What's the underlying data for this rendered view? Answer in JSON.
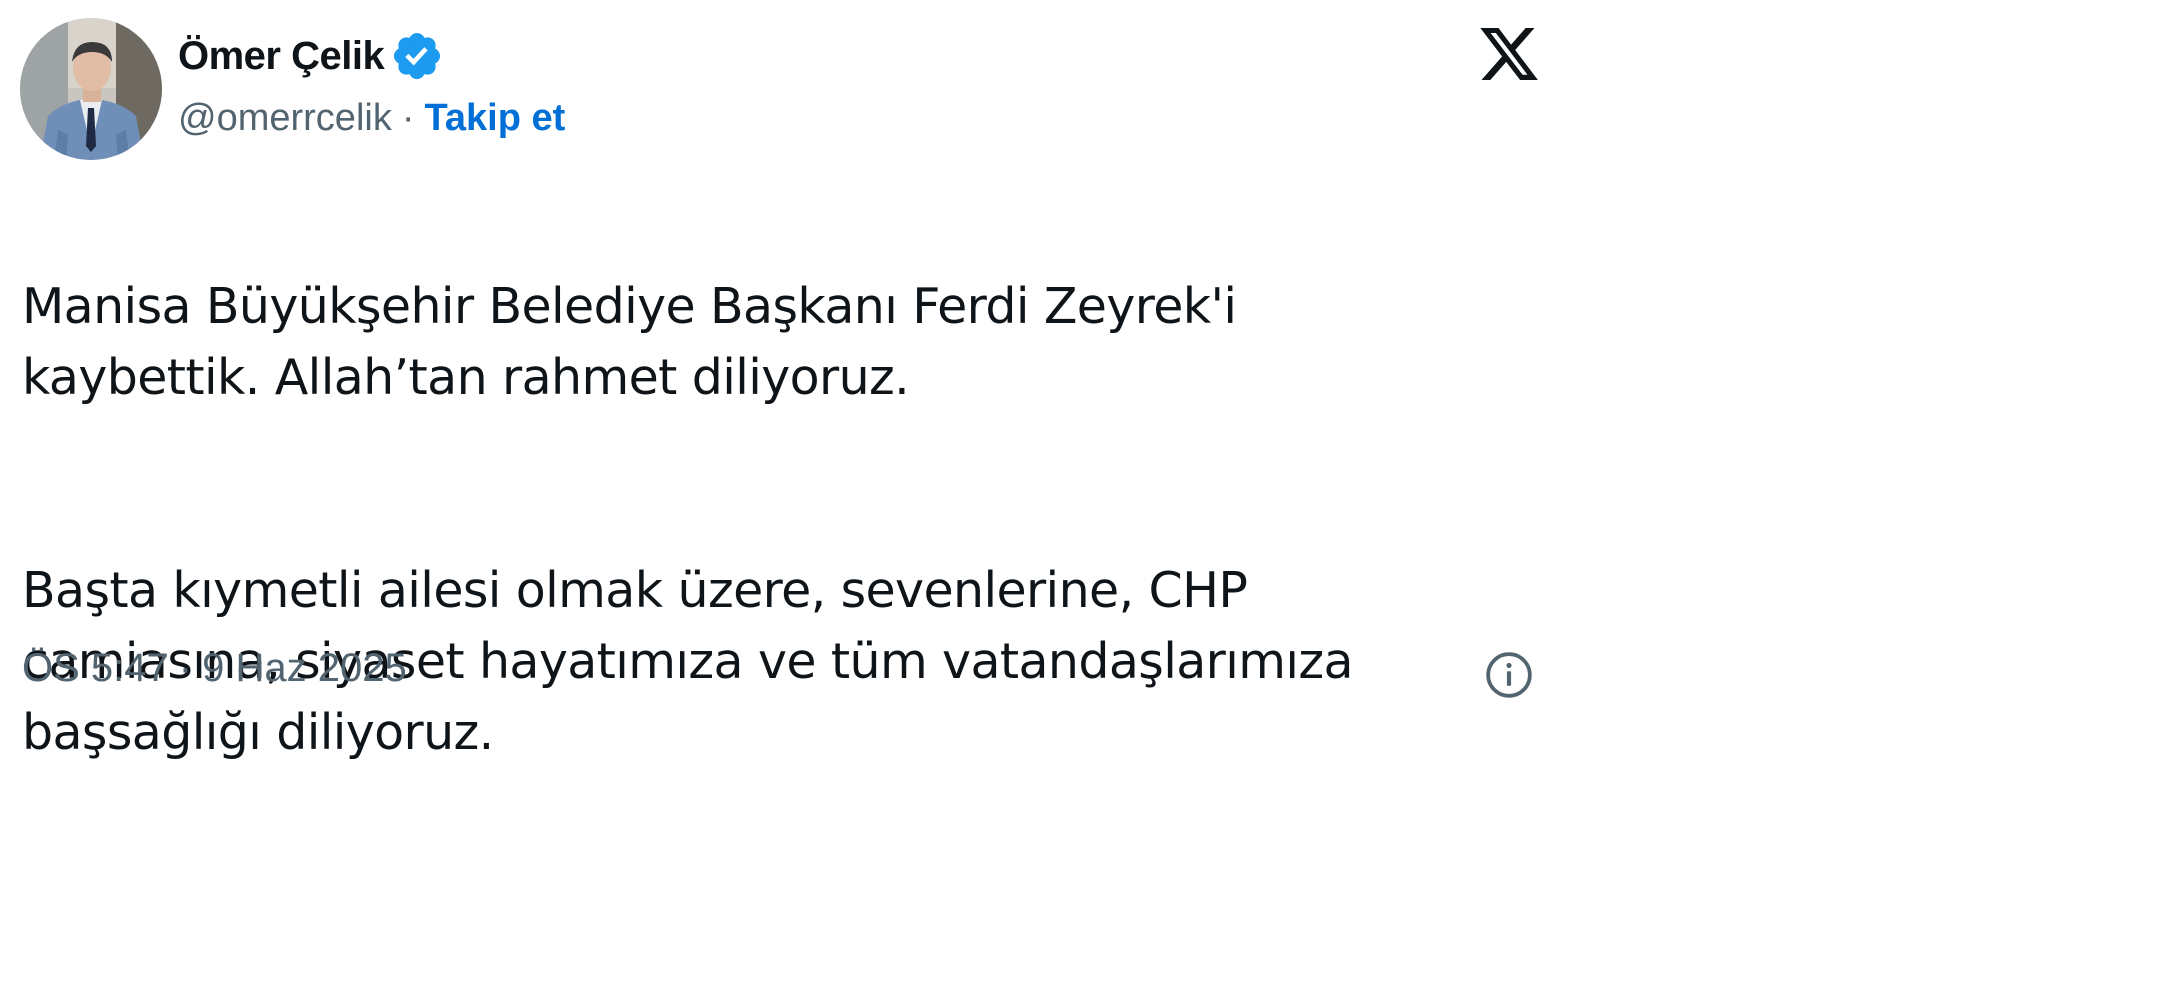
{
  "author": {
    "display_name": "Ömer Çelik",
    "handle": "@omerrcelik",
    "separator": "·",
    "follow_label": "Takip et",
    "verified_color": "#1d9bf0",
    "follow_color": "#006fd6"
  },
  "tweet": {
    "paragraph_1": "Manisa Büyükşehir Belediye Başkanı Ferdi Zeyrek'i\nkaybettik.  Allah’tan rahmet diliyoruz.",
    "paragraph_2": "Başta kıymetli ailesi olmak üzere, sevenlerine, CHP\ncamiasına, siyaset hayatımıza ve tüm vatandaşlarımıza\nbaşsağlığı diliyoruz."
  },
  "meta": {
    "time": "ÖS 5:47",
    "separator": "·",
    "date": "9 Haz 2025"
  },
  "icons": {
    "platform_logo": "x-logo-icon",
    "verified_badge": "verified-badge-icon",
    "info": "info-icon"
  },
  "colors": {
    "text_primary": "#0f1419",
    "text_secondary": "#536471",
    "background": "#ffffff"
  }
}
